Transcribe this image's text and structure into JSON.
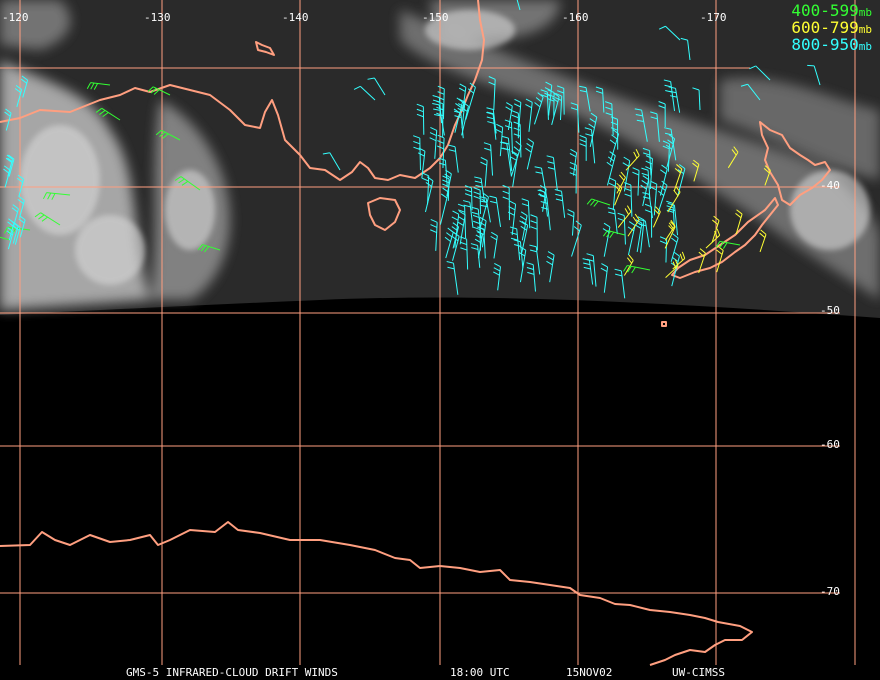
{
  "map": {
    "lon_labels": [
      "-120",
      "-130",
      "-140",
      "-150",
      "-160",
      "-170"
    ],
    "lat_labels": [
      "-40",
      "-50",
      "-60",
      "-70"
    ]
  },
  "legend": [
    {
      "range": "400-599",
      "unit": "mb",
      "color": "#33ff33"
    },
    {
      "range": "600-799",
      "unit": "mb",
      "color": "#ffff33"
    },
    {
      "range": "800-950",
      "unit": "mb",
      "color": "#33ffff"
    }
  ],
  "footer": {
    "product": "GMS-5 INFRARED-CLOUD DRIFT WINDS",
    "time": "18:00 UTC",
    "date": "15NOV02",
    "source": "UW-CIMSS"
  },
  "colors": {
    "coastline": "#ff9f80",
    "grid": "#ff9f80",
    "background": "#000000"
  }
}
